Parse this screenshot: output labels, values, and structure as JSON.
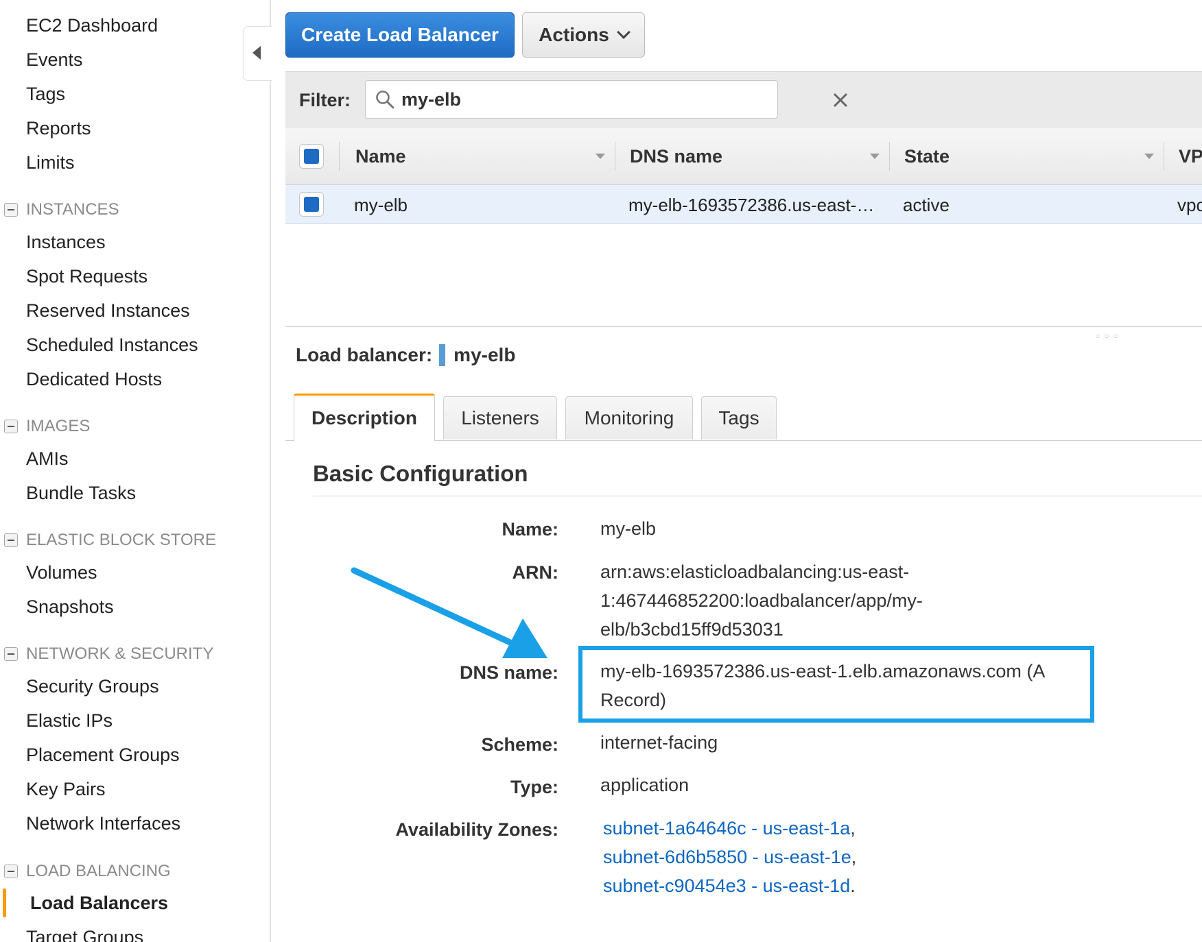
{
  "sidebar": {
    "top_items": [
      "EC2 Dashboard",
      "Events",
      "Tags",
      "Reports",
      "Limits"
    ],
    "sections": [
      {
        "title": "INSTANCES",
        "items": [
          "Instances",
          "Spot Requests",
          "Reserved Instances",
          "Scheduled Instances",
          "Dedicated Hosts"
        ]
      },
      {
        "title": "IMAGES",
        "items": [
          "AMIs",
          "Bundle Tasks"
        ]
      },
      {
        "title": "ELASTIC BLOCK STORE",
        "items": [
          "Volumes",
          "Snapshots"
        ]
      },
      {
        "title": "NETWORK & SECURITY",
        "items": [
          "Security Groups",
          "Elastic IPs",
          "Placement Groups",
          "Key Pairs",
          "Network Interfaces"
        ]
      },
      {
        "title": "LOAD BALANCING",
        "items": [
          "Load Balancers",
          "Target Groups"
        ]
      }
    ],
    "active_item": "Load Balancers",
    "accent_color": "#ff9900"
  },
  "toolbar": {
    "create_label": "Create Load Balancer",
    "actions_label": "Actions"
  },
  "filter": {
    "label": "Filter:",
    "value": "my-elb"
  },
  "table": {
    "columns": [
      "Name",
      "DNS name",
      "State",
      "VP"
    ],
    "rows": [
      {
        "name": "my-elb",
        "dns": "my-elb-1693572386.us-east-…",
        "state": "active",
        "vpc": "vpc"
      }
    ]
  },
  "detail": {
    "header_label": "Load balancer:",
    "header_name": "my-elb",
    "tabs": [
      "Description",
      "Listeners",
      "Monitoring",
      "Tags"
    ],
    "active_tab": "Description",
    "section_title": "Basic Configuration",
    "fields": {
      "name_label": "Name:",
      "name_value": "my-elb",
      "arn_label": "ARN:",
      "arn_line1": "arn:aws:elasticloadbalancing:us-east-",
      "arn_line2": "1:467446852200:loadbalancer/app/my-",
      "arn_line3": "elb/b3cbd15ff9d53031",
      "dns_label": "DNS name:",
      "dns_line1": "my-elb-1693572386.us-east-1.elb.amazonaws.com (A",
      "dns_line2": "Record)",
      "scheme_label": "Scheme:",
      "scheme_value": "internet-facing",
      "type_label": "Type:",
      "type_value": "application",
      "az_label": "Availability Zones:",
      "az_links": [
        "subnet-1a64646c - us-east-1a",
        "subnet-6d6b5850 - us-east-1e",
        "subnet-c90454e3 - us-east-1d"
      ],
      "az_separators": [
        ",",
        ",",
        "."
      ]
    },
    "highlight_color": "#1aa0e6",
    "link_color": "#0d66c2"
  }
}
